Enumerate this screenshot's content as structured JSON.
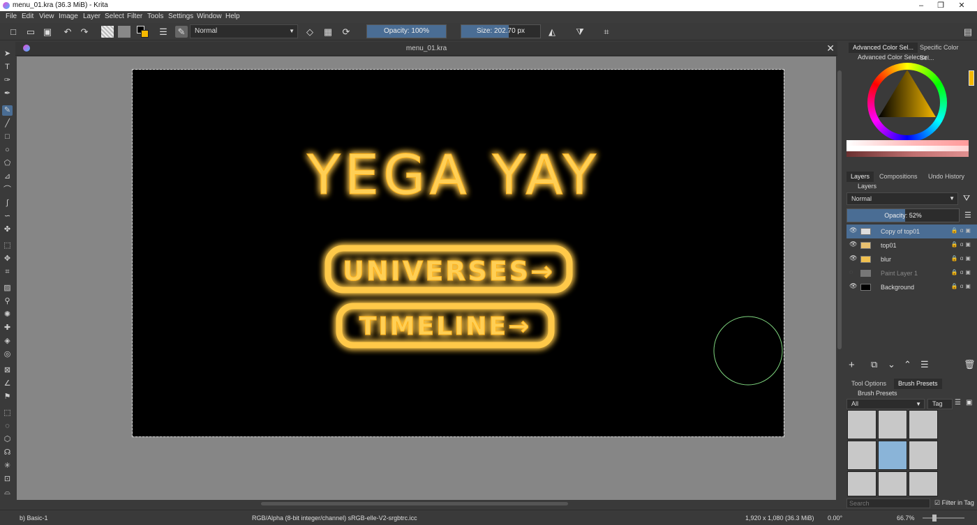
{
  "window": {
    "title": "menu_01.kra (36.3 MiB)  - Krita",
    "min": "–",
    "max": "❐",
    "close": "✕"
  },
  "menu": [
    "File",
    "Edit",
    "View",
    "Image",
    "Layer",
    "Select",
    "Filter",
    "Tools",
    "Settings",
    "Window",
    "Help"
  ],
  "toolbar": {
    "blend_mode": "Normal",
    "opacity": "Opacity: 100%",
    "opacity_fraction": 1.0,
    "size": "Size: 202.70 px",
    "size_fraction": 0.6
  },
  "document": {
    "tab_title": "menu_01.kra"
  },
  "artwork": {
    "title": "YEGA YAY",
    "button1": "UNIVERSES→",
    "button2": "TIMELINE→",
    "glow_color": "#ffb31a"
  },
  "dock": {
    "tabs_top": [
      "Advanced Color Sel...",
      "Specific Color Sel..."
    ],
    "color_selector_title": "Advanced Color Selector",
    "layer_tabs": [
      "Layers",
      "Compositions",
      "Undo History"
    ],
    "layers_title": "Layers",
    "layers_blend": "Normal",
    "layers_opacity": "Opacity:  52%",
    "layers_opacity_fraction": 0.52,
    "layers": [
      {
        "name": "Copy of top01",
        "visible": true,
        "selected": true
      },
      {
        "name": "top01",
        "visible": true,
        "selected": false
      },
      {
        "name": "blur",
        "visible": true,
        "selected": false
      },
      {
        "name": "Paint Layer 1",
        "visible": false,
        "selected": false
      },
      {
        "name": "Background",
        "visible": true,
        "selected": false
      }
    ],
    "bottom_tabs": [
      "Tool Options",
      "Brush Presets"
    ],
    "brush_title": "Brush Presets",
    "brush_filter": "All",
    "brush_tag": "Tag",
    "brush_search_placeholder": "Search",
    "filter_in_tag": "Filter in Tag"
  },
  "status": {
    "brush": "b) Basic-1",
    "color_space": "RGB/Alpha (8-bit integer/channel)  sRGB-elle-V2-srgbtrc.icc",
    "dimensions": "1,920 x 1,080 (36.3 MiB)",
    "rotation": "0.00°",
    "zoom": "66.7%"
  },
  "colors": {
    "accent": "#4a6d94",
    "bg": "#3a3a3a",
    "canvas_bg": "#868686"
  }
}
